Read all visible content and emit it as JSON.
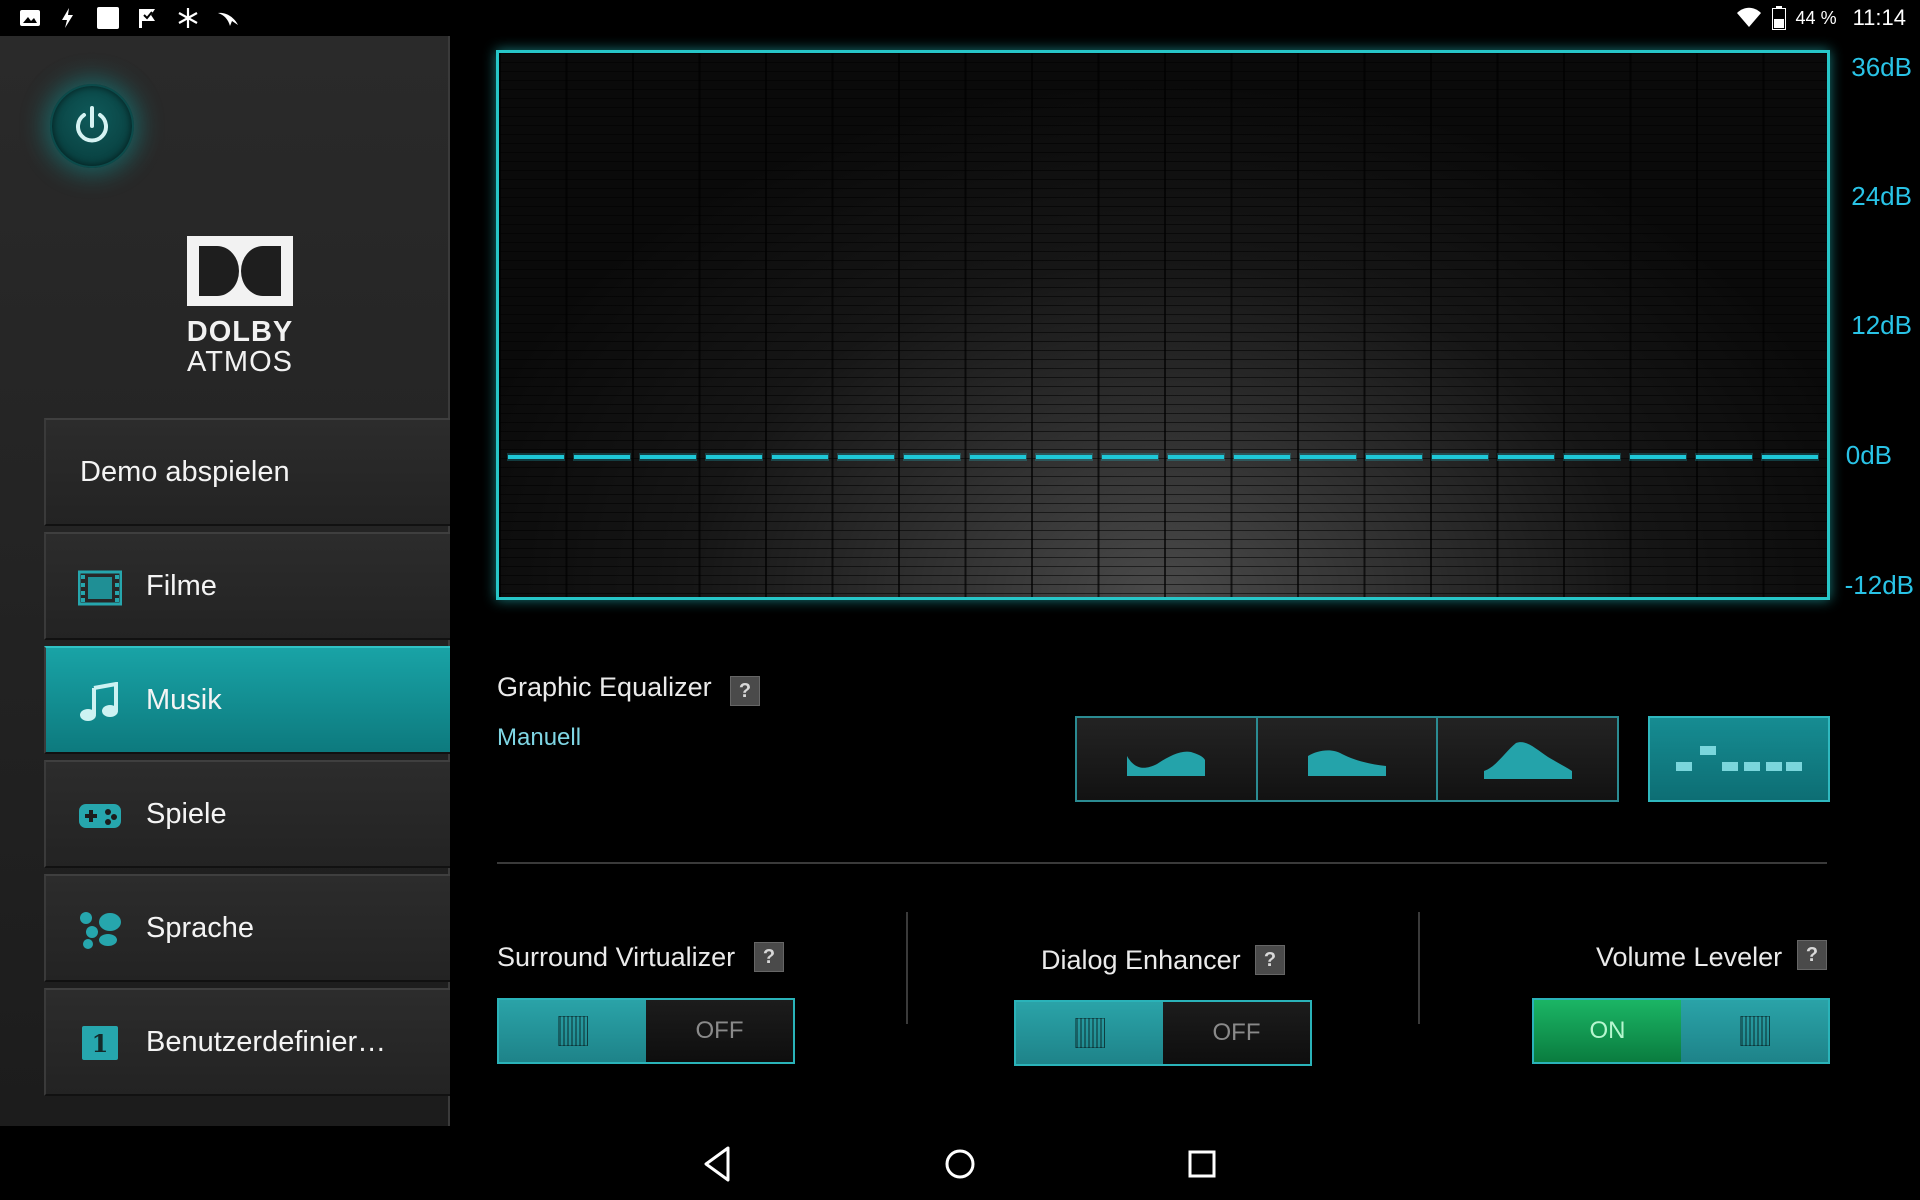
{
  "status_bar": {
    "left_icons": [
      "image-icon",
      "flash-icon",
      "white-square-icon",
      "flag-check-icon",
      "snowflake-icon",
      "bird-icon"
    ],
    "battery_percent": "44 %",
    "time": "11:14"
  },
  "sidebar": {
    "logo": {
      "line1": "DOLBY",
      "line2": "ATMOS"
    },
    "items": [
      {
        "label": "Demo abspielen",
        "icon": "",
        "active": false
      },
      {
        "label": "Filme",
        "icon": "film-icon",
        "active": false
      },
      {
        "label": "Musik",
        "icon": "music-note-icon",
        "active": true
      },
      {
        "label": "Spiele",
        "icon": "gamepad-icon",
        "active": false
      },
      {
        "label": "Sprache",
        "icon": "speech-people-icon",
        "active": false
      },
      {
        "label": "Benutzerdefinier…",
        "icon": "custom-1-icon",
        "active": false,
        "badge": "1"
      }
    ]
  },
  "equalizer": {
    "db_labels": [
      "36dB",
      "24dB",
      "12dB",
      "0dB",
      "-12dB"
    ],
    "bands": 20,
    "band_levels_db": [
      0,
      0,
      0,
      0,
      0,
      0,
      0,
      0,
      0,
      0,
      0,
      0,
      0,
      0,
      0,
      0,
      0,
      0,
      0,
      0
    ],
    "range_db": [
      -12,
      36
    ],
    "accent_color": "#1ec8d8"
  },
  "graphic_eq": {
    "title": "Graphic Equalizer",
    "help": "?",
    "preset": "Manuell",
    "presets": [
      "open-preset-icon",
      "rich-preset-icon",
      "focused-preset-icon",
      "manual-preset-icon"
    ],
    "selected_preset": "manual-preset-icon"
  },
  "toggles": {
    "surround": {
      "title": "Surround Virtualizer",
      "help": "?",
      "state_label": "OFF",
      "on": false
    },
    "dialog": {
      "title": "Dialog Enhancer",
      "help": "?",
      "state_label": "OFF",
      "on": false
    },
    "volume": {
      "title": "Volume Leveler",
      "help": "?",
      "state_label": "ON",
      "on": true
    }
  },
  "colors": {
    "accent": "#1ea3a8",
    "on_green": "#14a055"
  }
}
